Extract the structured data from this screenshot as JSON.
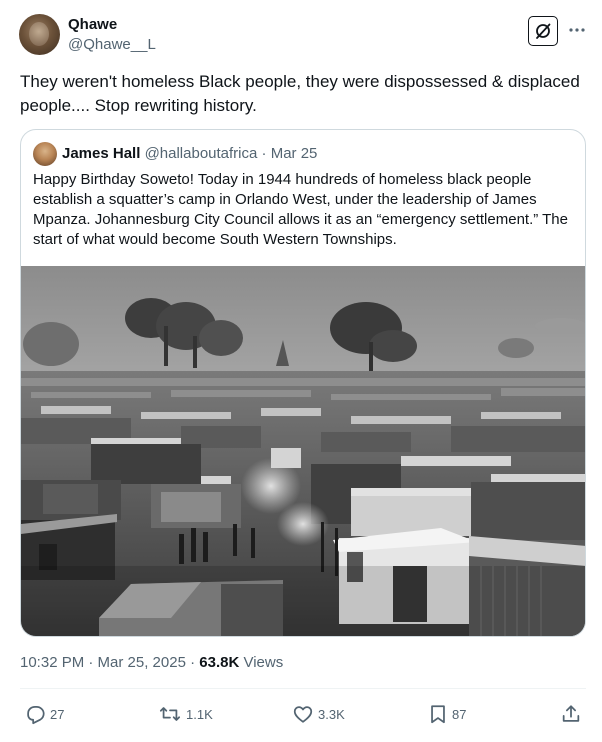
{
  "author": {
    "name": "Qhawe",
    "handle": "@Qhawe__L"
  },
  "tweet": {
    "text": "They weren't homeless Black people, they were dispossessed & displaced people.... Stop rewriting history."
  },
  "quoted": {
    "name": "James Hall",
    "handle": "@hallaboutafrica",
    "separator": "·",
    "date": "Mar 25",
    "text": "Happy Birthday Soweto! Today in 1944 hundreds of homeless black people establish a squatter’s camp in Orlando West, under the leadership of James Mpanza. Johannesburg City Council allows it as an “emergency settlement.” The start of what would become South Western Townships."
  },
  "meta": {
    "timestamp": "10:32 PM · Mar 25, 2025 · ",
    "views_count": "63.8K",
    "views_label": " Views"
  },
  "actions": {
    "replies": "27",
    "reposts": "1.1K",
    "likes": "3.3K",
    "bookmarks": "87"
  },
  "colors": {
    "text": "#0f1419",
    "muted": "#536471",
    "border": "#cfd9de"
  },
  "icons": [
    "grok-icon",
    "more-icon",
    "reply-icon",
    "repost-icon",
    "like-icon",
    "bookmark-icon",
    "share-icon"
  ]
}
